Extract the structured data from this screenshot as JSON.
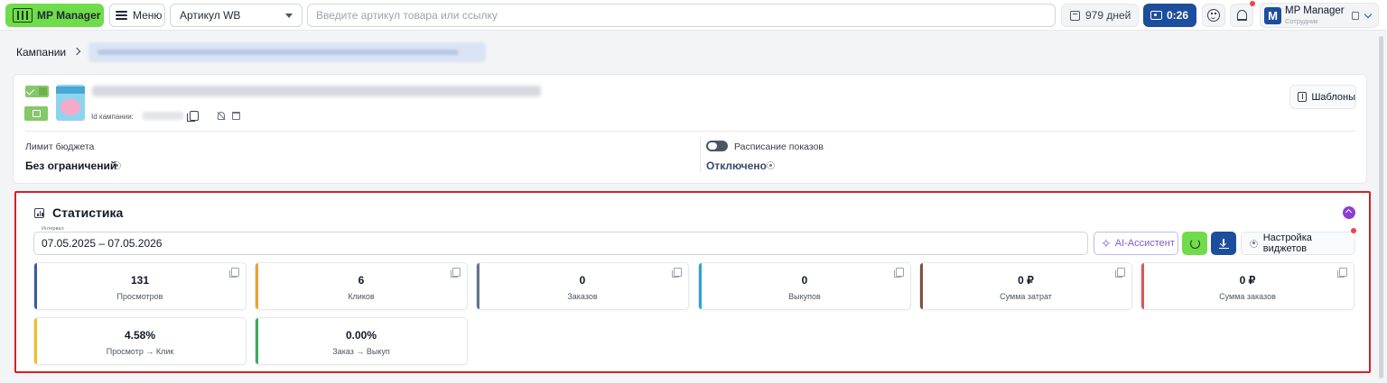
{
  "header": {
    "logo_label": "MP Manager",
    "menu_label": "Меню",
    "article_select_value": "Артикул WB",
    "search_placeholder": "Введите артикул товара или ссылку",
    "days_label": "979 дней",
    "timer_label": "0:26",
    "user": {
      "initial": "M",
      "name": "MP Manager",
      "role": "Сотрудник"
    }
  },
  "breadcrumb": {
    "root": "Кампании"
  },
  "campaign": {
    "id_label": "Id кампании:",
    "templates_label": "Шаблоны",
    "budget_label": "Лимит бюджета",
    "budget_value": "Без ограничений",
    "schedule_label": "Расписание показов",
    "schedule_value": "Отключено"
  },
  "statistics": {
    "title": "Статистика",
    "interval_legend": "Интервал",
    "interval_value": "07.05.2025 – 07.05.2026",
    "ai_label": "AI-Ассистент",
    "widgets_label": "Настройка виджетов",
    "metrics": [
      {
        "value": "131",
        "label": "Просмотров",
        "color": "#3b5a9a"
      },
      {
        "value": "6",
        "label": "Кликов",
        "color": "#f0a030"
      },
      {
        "value": "0",
        "label": "Заказов",
        "color": "#64748b"
      },
      {
        "value": "0",
        "label": "Выкупов",
        "color": "#29a3dc"
      },
      {
        "value": "0 ₽",
        "label": "Сумма затрат",
        "color": "#7a5240"
      },
      {
        "value": "0 ₽",
        "label": "Сумма заказов",
        "color": "#e05656"
      },
      {
        "value": "4.58%",
        "label": "Просмотр → Клик",
        "color": "#f0c020"
      },
      {
        "value": "0.00%",
        "label": "Заказ → Выкуп",
        "color": "#3aaa5a"
      }
    ]
  },
  "colors": {
    "brand_green": "#6fdc4a",
    "brand_blue": "#1d4e9e",
    "highlight_red": "#d61f26",
    "ai_purple": "#7c5cd6"
  }
}
